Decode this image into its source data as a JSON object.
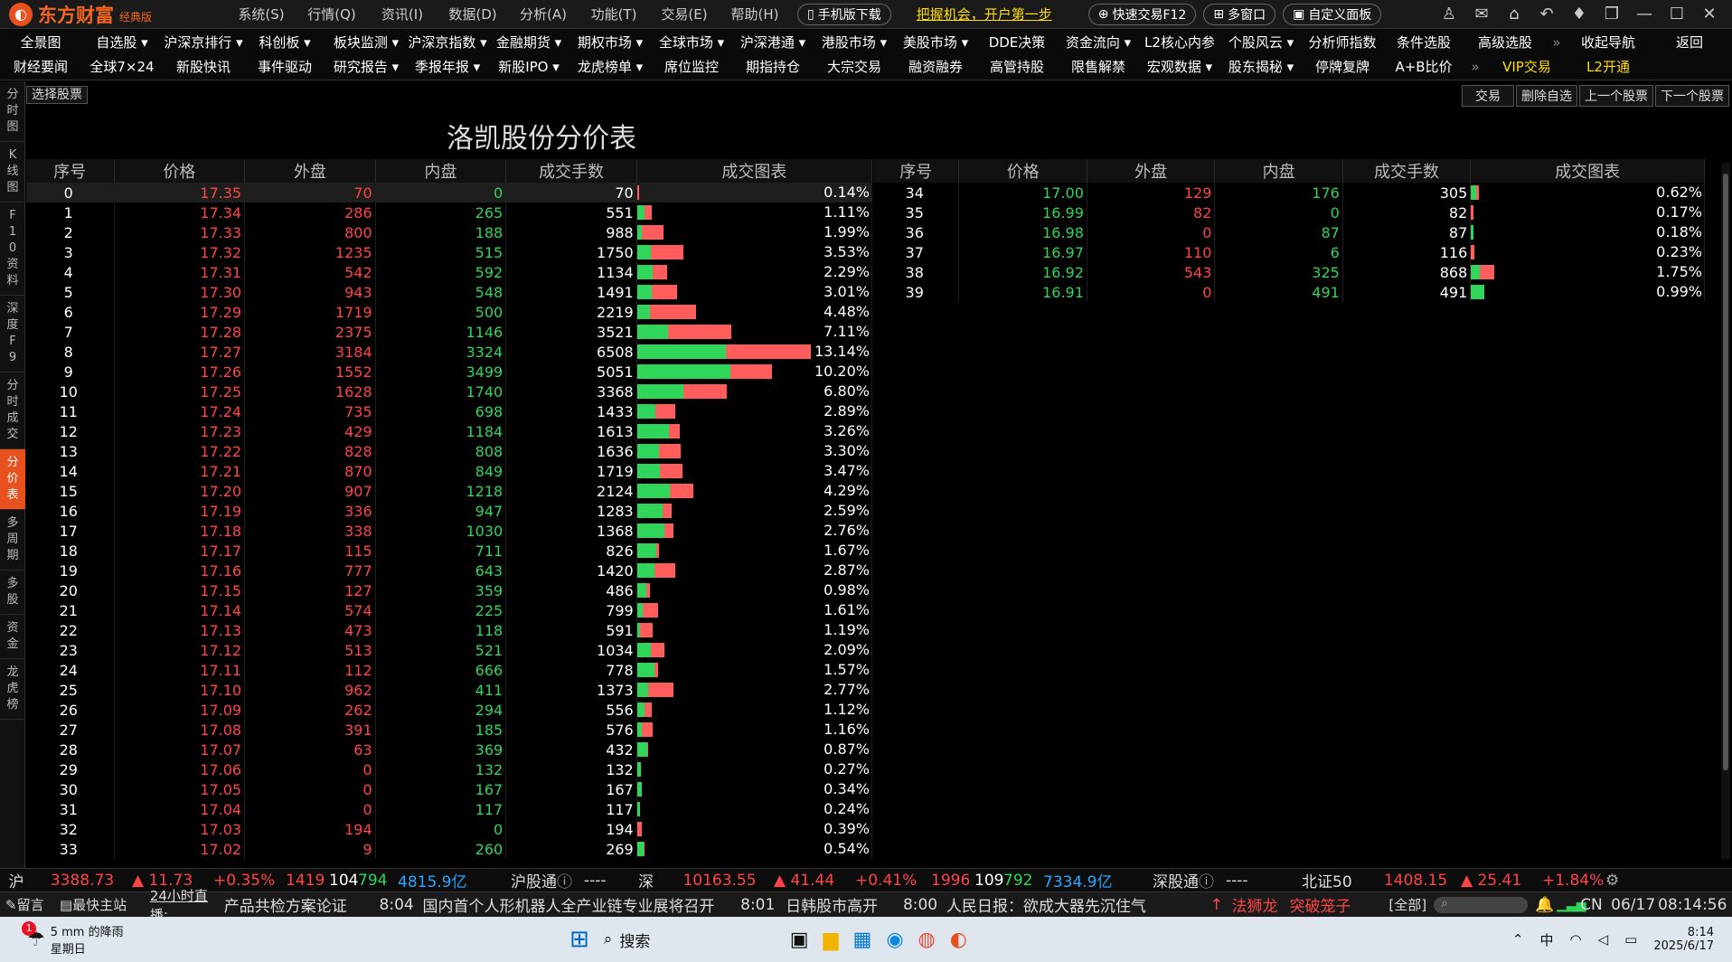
{
  "app": {
    "logo_text": "东方财富",
    "logo_sub": "经典版",
    "menus": [
      "系统(S)",
      "行情(Q)",
      "资讯(I)",
      "数据(D)",
      "分析(A)",
      "功能(T)",
      "交易(E)",
      "帮助(H)"
    ],
    "mobile_btn": "手机版下载",
    "promo": "把握机会，开户第一步",
    "quick_trade": "快速交易F12",
    "multi_window": "多窗口",
    "custom_panel": "自定义面板"
  },
  "nav1": [
    "全景图",
    "自选股 ▾",
    "沪深京排行 ▾",
    "科创板 ▾",
    "板块监测 ▾",
    "沪深京指数 ▾",
    "金融期货 ▾",
    "期权市场 ▾",
    "全球市场 ▾",
    "沪深港通 ▾",
    "港股市场 ▾",
    "美股市场 ▾",
    "DDE决策",
    "资金流向 ▾",
    "L2核心内参",
    "个股风云 ▾",
    "分析师指数",
    "条件选股",
    "高级选股",
    "»",
    "收起导航",
    "返回"
  ],
  "nav2": [
    "财经要闻",
    "全球7×24",
    "新股快讯",
    "事件驱动",
    "研究报告 ▾",
    "季报年报 ▾",
    "新股IPO ▾",
    "龙虎榜单 ▾",
    "席位监控",
    "期指持仓",
    "大宗交易",
    "融资融券",
    "高管持股",
    "限售解禁",
    "宏观数据 ▾",
    "股东揭秘 ▾",
    "停牌复牌",
    "A+B比价",
    "»",
    "VIP交易",
    "L2开通"
  ],
  "sidebar": [
    "分时图",
    "K线图",
    "F10资料",
    "深度F9",
    "分时成交",
    "分价表",
    "多周期",
    "多股",
    "资金",
    "龙虎榜"
  ],
  "buttons": {
    "select_stock": "选择股票",
    "trade": "交易",
    "delete_fav": "删除自选",
    "prev": "上一个股票",
    "next": "下一个股票"
  },
  "title": "洛凯股份分价表",
  "headers": [
    "序号",
    "价格",
    "外盘",
    "内盘",
    "成交手数",
    "成交图表"
  ],
  "rows_left": [
    [
      0,
      "17.35",
      70,
      0,
      70,
      "0.14%"
    ],
    [
      1,
      "17.34",
      286,
      265,
      551,
      "1.11%"
    ],
    [
      2,
      "17.33",
      800,
      188,
      988,
      "1.99%"
    ],
    [
      3,
      "17.32",
      1235,
      515,
      1750,
      "3.53%"
    ],
    [
      4,
      "17.31",
      542,
      592,
      1134,
      "2.29%"
    ],
    [
      5,
      "17.30",
      943,
      548,
      1491,
      "3.01%"
    ],
    [
      6,
      "17.29",
      1719,
      500,
      2219,
      "4.48%"
    ],
    [
      7,
      "17.28",
      2375,
      1146,
      3521,
      "7.11%"
    ],
    [
      8,
      "17.27",
      3184,
      3324,
      6508,
      "13.14%"
    ],
    [
      9,
      "17.26",
      1552,
      3499,
      5051,
      "10.20%"
    ],
    [
      10,
      "17.25",
      1628,
      1740,
      3368,
      "6.80%"
    ],
    [
      11,
      "17.24",
      735,
      698,
      1433,
      "2.89%"
    ],
    [
      12,
      "17.23",
      429,
      1184,
      1613,
      "3.26%"
    ],
    [
      13,
      "17.22",
      828,
      808,
      1636,
      "3.30%"
    ],
    [
      14,
      "17.21",
      870,
      849,
      1719,
      "3.47%"
    ],
    [
      15,
      "17.20",
      907,
      1218,
      2124,
      "4.29%"
    ],
    [
      16,
      "17.19",
      336,
      947,
      1283,
      "2.59%"
    ],
    [
      17,
      "17.18",
      338,
      1030,
      1368,
      "2.76%"
    ],
    [
      18,
      "17.17",
      115,
      711,
      826,
      "1.67%"
    ],
    [
      19,
      "17.16",
      777,
      643,
      1420,
      "2.87%"
    ],
    [
      20,
      "17.15",
      127,
      359,
      486,
      "0.98%"
    ],
    [
      21,
      "17.14",
      574,
      225,
      799,
      "1.61%"
    ],
    [
      22,
      "17.13",
      473,
      118,
      591,
      "1.19%"
    ],
    [
      23,
      "17.12",
      513,
      521,
      1034,
      "2.09%"
    ],
    [
      24,
      "17.11",
      112,
      666,
      778,
      "1.57%"
    ],
    [
      25,
      "17.10",
      962,
      411,
      1373,
      "2.77%"
    ],
    [
      26,
      "17.09",
      262,
      294,
      556,
      "1.12%"
    ],
    [
      27,
      "17.08",
      391,
      185,
      576,
      "1.16%"
    ],
    [
      28,
      "17.07",
      63,
      369,
      432,
      "0.87%"
    ],
    [
      29,
      "17.06",
      0,
      132,
      132,
      "0.27%"
    ],
    [
      30,
      "17.05",
      0,
      167,
      167,
      "0.34%"
    ],
    [
      31,
      "17.04",
      0,
      117,
      117,
      "0.24%"
    ],
    [
      32,
      "17.03",
      194,
      0,
      194,
      "0.39%"
    ],
    [
      33,
      "17.02",
      9,
      260,
      269,
      "0.54%"
    ]
  ],
  "rows_right": [
    [
      34,
      "17.00",
      129,
      176,
      305,
      "0.62%"
    ],
    [
      35,
      "16.99",
      82,
      0,
      82,
      "0.17%"
    ],
    [
      36,
      "16.98",
      0,
      87,
      87,
      "0.18%"
    ],
    [
      37,
      "16.97",
      110,
      6,
      116,
      "0.23%"
    ],
    [
      38,
      "16.92",
      543,
      325,
      868,
      "1.75%"
    ],
    [
      39,
      "16.91",
      0,
      491,
      491,
      "0.99%"
    ]
  ],
  "status": {
    "sh_label": "沪",
    "sh_index": "3388.73",
    "sh_chg": "▲ 11.73",
    "sh_pct": "+0.35%",
    "sh_up": "1419",
    "sh_flat": "104",
    "sh_down": "794",
    "sh_amt": "4815.9亿",
    "hgt": "沪股通",
    "hgt_val": "----",
    "sz_label": "深",
    "sz_index": "10163.55",
    "sz_chg": "▲ 41.44",
    "sz_pct": "+0.41%",
    "sz_up": "1996",
    "sz_flat": "109",
    "sz_down": "792",
    "sz_amt": "7334.9亿",
    "sgt": "深股通",
    "sgt_val": "----",
    "bz": "北证50",
    "bz_index": "1408.15",
    "bz_chg": "▲ 25.41",
    "bz_pct": "+1.84%"
  },
  "ticker": {
    "msg": "留言",
    "fast": "最快主站",
    "live": "24小时直播:",
    "t1": "产品共检方案论证",
    "time1": "8:04",
    "n1": "国内首个人形机器人全产业链专业展将召开",
    "time2": "8:01",
    "n2": "日韩股市高开",
    "time3": "8:00",
    "n3": "人民日报：欲成大器先沉住气",
    "hot1": "法狮龙",
    "hot2": "突破笼子",
    "all": "[全部]",
    "cn": "CN",
    "date": "06/17",
    "clock": "08:14:56"
  },
  "taskbar": {
    "weather": "5 mm 的降雨",
    "day": "星期日",
    "search": "搜索",
    "ime": "中",
    "time": "8:14",
    "date": "2025/6/17",
    "badge": "1"
  }
}
